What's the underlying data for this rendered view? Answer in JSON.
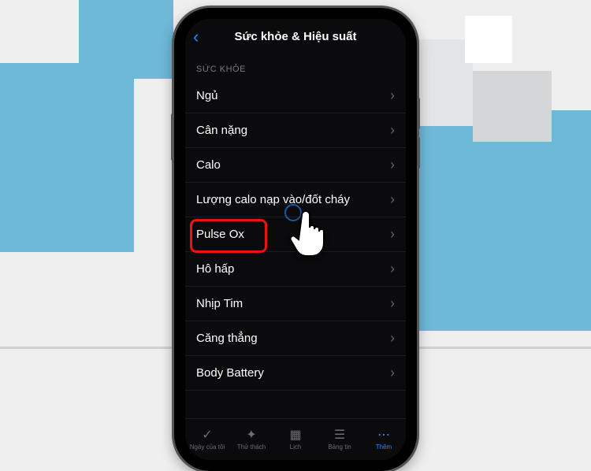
{
  "header": {
    "title": "Sức khỏe & Hiệu suất"
  },
  "section": {
    "label": "SỨC KHỎE"
  },
  "rows": {
    "0": "Ngủ",
    "1": "Cân nặng",
    "2": "Calo",
    "3": "Lượng calo nạp vào/đốt cháy",
    "4": "Pulse Ox",
    "5": "Hô hấp",
    "6": "Nhịp Tim",
    "7": "Căng thẳng",
    "8": "Body Battery"
  },
  "tabs": {
    "0": {
      "label": "Ngày của tôi",
      "icon": "✓"
    },
    "1": {
      "label": "Thử thách",
      "icon": "✦"
    },
    "2": {
      "label": "Lịch",
      "icon": "▦"
    },
    "3": {
      "label": "Bảng tin",
      "icon": "☰"
    },
    "4": {
      "label": "Thêm",
      "icon": "⋯"
    }
  }
}
